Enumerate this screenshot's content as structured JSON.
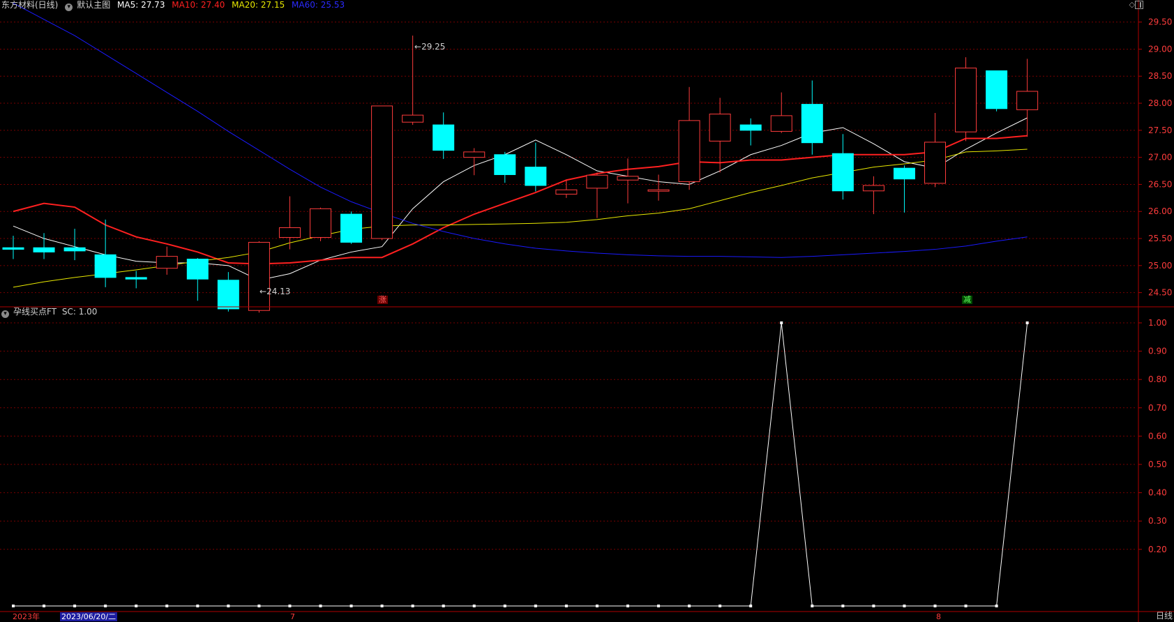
{
  "header": {
    "stock_name": "东方材料(日线)",
    "main_chart_label": "默认主图",
    "ma5_label": "MA5: 27.73",
    "ma10_label": "MA10: 27.40",
    "ma20_label": "MA20: 27.15",
    "ma60_label": "MA60: 25.53",
    "ma_colors": {
      "ma5": "#ffffff",
      "ma10": "#ff2020",
      "ma20": "#e8e800",
      "ma60": "#1a1aff"
    }
  },
  "indicator_header": {
    "name": "孕线买点FT",
    "value_label": "SC: 1.00"
  },
  "top_right_icons": [
    "diamond-icon",
    "panel-toggle-icon"
  ],
  "annotations": {
    "high_label": "29.25",
    "low_label": "24.13",
    "tag_up": "涨",
    "tag_down": "减"
  },
  "bottom_axis": {
    "year_label": "2023年",
    "cursor_date": "2023/06/20/二",
    "month_labels": [
      "7",
      "8"
    ],
    "period_button": "日线"
  },
  "colors": {
    "up": "#ff3c3c",
    "down": "#00ffff",
    "grid": "#7a0000",
    "axis": "#b00000"
  },
  "chart_data": [
    {
      "type": "candlestick",
      "title": "",
      "ylim": [
        24.0,
        29.65
      ],
      "y_ticks": [
        24.5,
        25.0,
        25.5,
        26.0,
        26.5,
        27.0,
        27.5,
        28.0,
        28.5,
        29.0,
        29.5
      ],
      "y_tick_labels": [
        "24.50",
        "25.00",
        "25.50",
        "26.00",
        "26.50",
        "27.00",
        "27.50",
        "28.00",
        "28.50",
        "29.00",
        "29.50"
      ],
      "candles": [
        {
          "o": 25.33,
          "c": 25.3,
          "h": 25.55,
          "l": 25.12
        },
        {
          "o": 25.33,
          "c": 25.25,
          "h": 25.6,
          "l": 25.12
        },
        {
          "o": 25.33,
          "c": 25.27,
          "h": 25.68,
          "l": 25.1
        },
        {
          "o": 25.2,
          "c": 24.78,
          "h": 25.85,
          "l": 24.6
        },
        {
          "o": 24.78,
          "c": 24.75,
          "h": 24.9,
          "l": 24.58
        },
        {
          "o": 24.95,
          "c": 25.17,
          "h": 25.35,
          "l": 24.83
        },
        {
          "o": 25.12,
          "c": 24.75,
          "h": 25.14,
          "l": 24.35
        },
        {
          "o": 24.73,
          "c": 24.2,
          "h": 24.88,
          "l": 24.15
        },
        {
          "o": 24.17,
          "c": 25.43,
          "h": 25.45,
          "l": 24.13
        },
        {
          "o": 25.52,
          "c": 25.7,
          "h": 26.28,
          "l": 25.3
        },
        {
          "o": 25.52,
          "c": 26.05,
          "h": 26.07,
          "l": 25.45
        },
        {
          "o": 25.95,
          "c": 25.43,
          "h": 26.0,
          "l": 25.4
        },
        {
          "o": 25.5,
          "c": 27.95,
          "h": 27.95,
          "l": 25.47
        },
        {
          "o": 27.65,
          "c": 27.78,
          "h": 29.25,
          "l": 27.6
        },
        {
          "o": 27.6,
          "c": 27.13,
          "h": 27.83,
          "l": 26.97
        },
        {
          "o": 27.0,
          "c": 27.1,
          "h": 27.17,
          "l": 26.67
        },
        {
          "o": 27.05,
          "c": 26.68,
          "h": 27.1,
          "l": 26.53
        },
        {
          "o": 26.82,
          "c": 26.48,
          "h": 27.27,
          "l": 26.37
        },
        {
          "o": 26.32,
          "c": 26.4,
          "h": 26.58,
          "l": 26.25
        },
        {
          "o": 26.43,
          "c": 26.67,
          "h": 26.72,
          "l": 25.88
        },
        {
          "o": 26.58,
          "c": 26.65,
          "h": 26.98,
          "l": 26.15
        },
        {
          "o": 26.38,
          "c": 26.4,
          "h": 26.68,
          "l": 26.2
        },
        {
          "o": 26.55,
          "c": 27.68,
          "h": 28.3,
          "l": 26.4
        },
        {
          "o": 27.3,
          "c": 27.8,
          "h": 28.1,
          "l": 26.72
        },
        {
          "o": 27.6,
          "c": 27.5,
          "h": 27.72,
          "l": 27.22
        },
        {
          "o": 27.48,
          "c": 27.77,
          "h": 28.2,
          "l": 27.45
        },
        {
          "o": 27.98,
          "c": 27.27,
          "h": 28.42,
          "l": 27.05
        },
        {
          "o": 27.07,
          "c": 26.38,
          "h": 27.43,
          "l": 26.22
        },
        {
          "o": 26.38,
          "c": 26.48,
          "h": 26.65,
          "l": 25.95
        },
        {
          "o": 26.8,
          "c": 26.6,
          "h": 26.85,
          "l": 25.98
        },
        {
          "o": 26.52,
          "c": 27.28,
          "h": 27.82,
          "l": 26.45
        },
        {
          "o": 27.47,
          "c": 28.65,
          "h": 28.85,
          "l": 27.3
        },
        {
          "o": 28.6,
          "c": 27.9,
          "h": 28.6,
          "l": 27.85
        },
        {
          "o": 27.88,
          "c": 28.22,
          "h": 28.82,
          "l": 27.38
        }
      ],
      "series": [
        {
          "name": "MA5",
          "values": [
            25.73,
            25.5,
            25.35,
            25.2,
            25.08,
            25.05,
            25.05,
            25.0,
            24.73,
            24.85,
            25.1,
            25.25,
            25.35,
            26.05,
            26.55,
            26.85,
            27.05,
            27.32,
            27.05,
            26.75,
            26.65,
            26.55,
            26.5,
            26.75,
            27.05,
            27.22,
            27.45,
            27.55,
            27.25,
            26.92,
            26.8,
            27.15,
            27.45,
            27.73
          ]
        },
        {
          "name": "MA10",
          "values": [
            26.0,
            26.15,
            26.08,
            25.75,
            25.53,
            25.4,
            25.25,
            25.05,
            25.03,
            25.05,
            25.1,
            25.15,
            25.15,
            25.4,
            25.7,
            25.95,
            26.15,
            26.35,
            26.58,
            26.7,
            26.78,
            26.83,
            26.92,
            26.9,
            26.95,
            26.95,
            27.0,
            27.05,
            27.05,
            27.05,
            27.1,
            27.35,
            27.35,
            27.4
          ]
        },
        {
          "name": "MA20",
          "values": [
            24.6,
            24.7,
            24.78,
            24.85,
            24.92,
            25.0,
            25.08,
            25.15,
            25.25,
            25.42,
            25.55,
            25.67,
            25.73,
            25.75,
            25.75,
            25.76,
            25.77,
            25.78,
            25.8,
            25.85,
            25.92,
            25.97,
            26.05,
            26.2,
            26.35,
            26.48,
            26.62,
            26.72,
            26.82,
            26.88,
            26.95,
            27.1,
            27.12,
            27.15
          ]
        },
        {
          "name": "MA60",
          "values": [
            29.85,
            29.55,
            29.25,
            28.9,
            28.55,
            28.2,
            27.85,
            27.48,
            27.13,
            26.78,
            26.45,
            26.18,
            25.97,
            25.78,
            25.63,
            25.5,
            25.4,
            25.32,
            25.27,
            25.23,
            25.2,
            25.18,
            25.17,
            25.17,
            25.16,
            25.15,
            25.17,
            25.2,
            25.23,
            25.26,
            25.3,
            25.36,
            25.45,
            25.53
          ]
        }
      ]
    },
    {
      "type": "line",
      "title": "",
      "ylim": [
        0,
        1.05
      ],
      "y_ticks": [
        0.2,
        0.3,
        0.4,
        0.5,
        0.6,
        0.7,
        0.8,
        0.9,
        1.0
      ],
      "y_tick_labels": [
        "0.20",
        "0.30",
        "0.40",
        "0.50",
        "0.60",
        "0.70",
        "0.80",
        "0.90",
        "1.00"
      ],
      "series": [
        {
          "name": "SC",
          "values": [
            0,
            0,
            0,
            0,
            0,
            0,
            0,
            0,
            0,
            0,
            0,
            0,
            0,
            0,
            0,
            0,
            0,
            0,
            0,
            0,
            0,
            0,
            0,
            0,
            0,
            1,
            0,
            0,
            0,
            0,
            0,
            0,
            0,
            1
          ]
        }
      ]
    }
  ]
}
